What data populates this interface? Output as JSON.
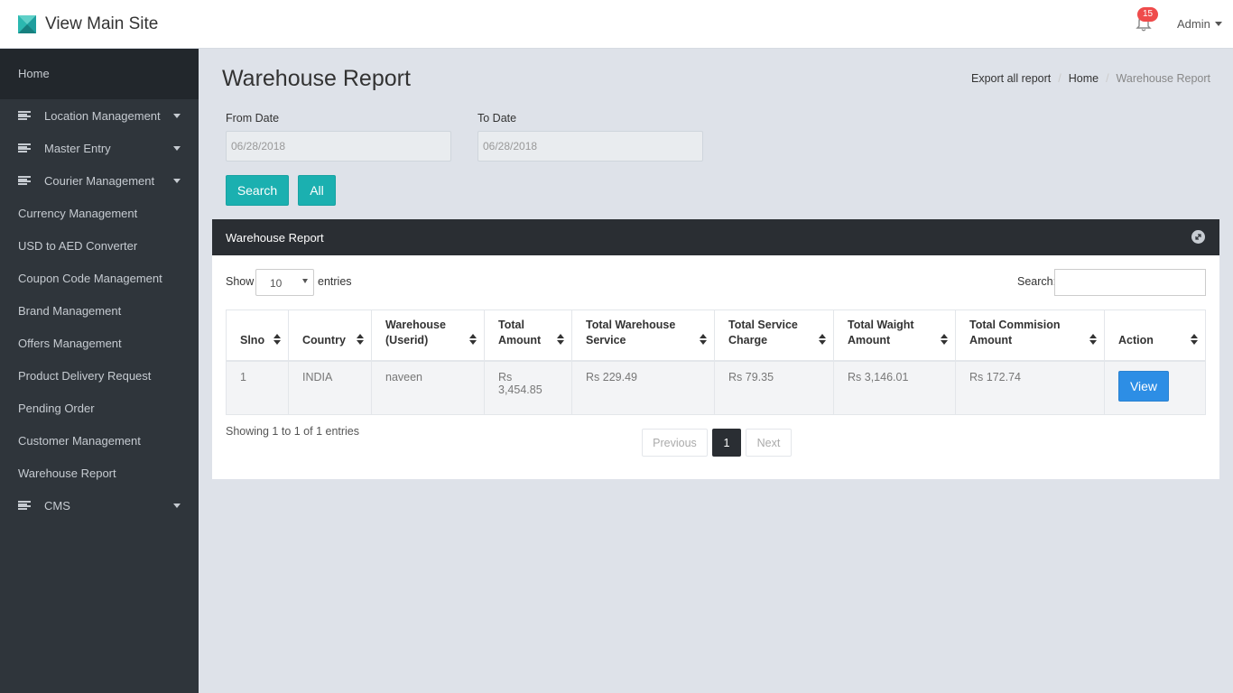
{
  "header": {
    "site_title": "View Main Site",
    "notification_count": "15",
    "user_label": "Admin"
  },
  "sidebar": {
    "home": "Home",
    "items": [
      {
        "label": "Location Management",
        "has_icon": true,
        "has_caret": true
      },
      {
        "label": "Master Entry",
        "has_icon": true,
        "has_caret": true
      },
      {
        "label": "Courier Management",
        "has_icon": true,
        "has_caret": true
      },
      {
        "label": "Currency Management"
      },
      {
        "label": "USD to AED Converter"
      },
      {
        "label": "Coupon Code Management"
      },
      {
        "label": "Brand Management"
      },
      {
        "label": "Offers Management"
      },
      {
        "label": "Product Delivery Request"
      },
      {
        "label": "Pending Order"
      },
      {
        "label": "Customer Management"
      },
      {
        "label": "Warehouse Report"
      },
      {
        "label": "CMS",
        "has_icon": true,
        "has_caret": true
      }
    ]
  },
  "page": {
    "title": "Warehouse Report",
    "breadcrumb": {
      "export": "Export all report",
      "home": "Home",
      "current": "Warehouse Report"
    }
  },
  "filters": {
    "from_label": "From Date",
    "from_value": "06/28/2018",
    "to_label": "To Date",
    "to_value": "06/28/2018",
    "search_button": "Search",
    "all_button": "All"
  },
  "report": {
    "panel_title": "Warehouse Report",
    "show_label": "Show",
    "entries_value": "10",
    "entries_label": "entries",
    "search_label": "Search:",
    "columns": [
      "Slno",
      "Country",
      "Warehouse (Userid)",
      "Total Amount",
      "Total Warehouse Service",
      "Total Service Charge",
      "Total Waight Amount",
      "Total Commision Amount",
      "Action"
    ],
    "rows": [
      {
        "slno": "1",
        "country": "INDIA",
        "warehouse": "naveen",
        "total_amount": "Rs 3,454.85",
        "warehouse_service": "Rs 229.49",
        "service_charge": "Rs 79.35",
        "weight_amount": "Rs 3,146.01",
        "commission_amount": "Rs 172.74",
        "action": "View"
      }
    ],
    "info": "Showing 1 to 1 of 1 entries",
    "pagination": {
      "previous": "Previous",
      "current": "1",
      "next": "Next"
    }
  },
  "colors": {
    "sidebar_bg": "#2f353b",
    "teal_button": "#1bb0b0",
    "view_button": "#2d8ee5",
    "badge": "#ef4b4b",
    "panel_header": "#2a2e33"
  }
}
